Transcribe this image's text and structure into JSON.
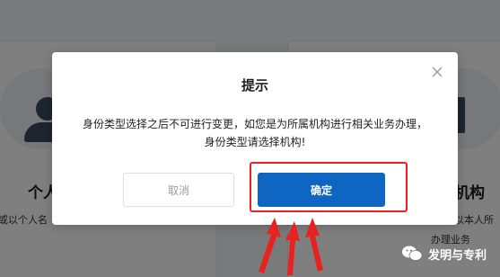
{
  "background": {
    "left_card": {
      "title": "个人",
      "description": "或以个人名"
    },
    "right_card": {
      "title": "机构",
      "description": "以本人所",
      "description2": "办理业务"
    }
  },
  "dialog": {
    "title": "提示",
    "message_line1": "身份类型选择之后不可进行变更，如您是为所属机构进行相关业务办理，",
    "message_line2": "身份类型请选择机构!",
    "cancel_label": "取消",
    "confirm_label": "确定"
  },
  "watermark": {
    "text": "发明与专利"
  },
  "colors": {
    "primary": "#0e66c2",
    "highlight": "#e8231f",
    "overlay": "rgba(0,0,0,0.5)"
  }
}
